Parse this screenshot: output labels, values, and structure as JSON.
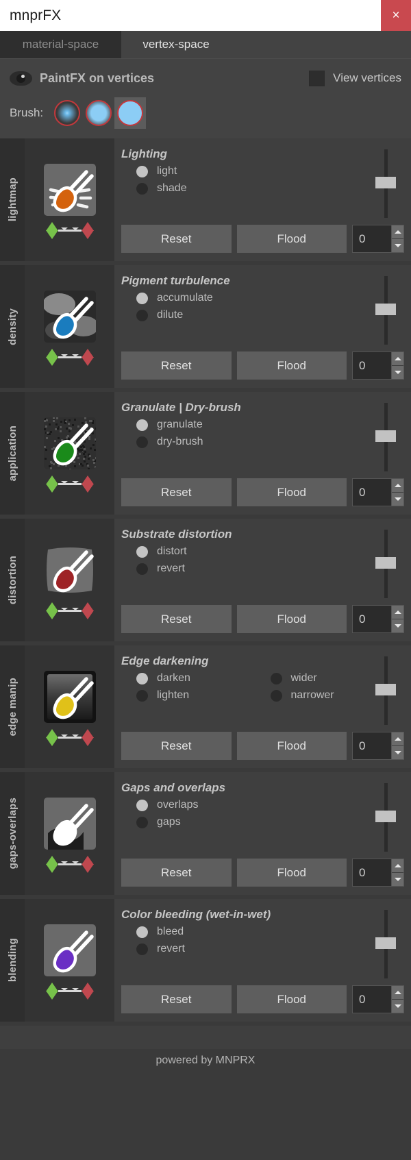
{
  "window": {
    "title": "mnprFX",
    "close_label": "×"
  },
  "tabs": [
    {
      "label": "material-space",
      "active": false
    },
    {
      "label": "vertex-space",
      "active": true
    }
  ],
  "top": {
    "eye_icon": "eye-icon",
    "paintfx_label": "PaintFX on vertices",
    "view_vertices_label": "View vertices",
    "view_vertices_checked": false,
    "brush_label": "Brush:",
    "brushes": [
      {
        "name": "brush-soft",
        "selected": false
      },
      {
        "name": "brush-medium",
        "selected": false
      },
      {
        "name": "brush-hard",
        "selected": true
      }
    ]
  },
  "buttons": {
    "reset_label": "Reset",
    "flood_label": "Flood"
  },
  "colors": {
    "accent_red": "#c4383c",
    "brush_blue": "#8ccdf5",
    "close_red": "#c9494f",
    "gradient_low": "#77c24a",
    "gradient_high": "#c0484f"
  },
  "panels": [
    {
      "rail": "lightmap",
      "title": "Lighting",
      "thumb_color": "#d4620d",
      "thumb_style": "rays",
      "options": [
        {
          "label": "light",
          "selected": true
        },
        {
          "label": "shade",
          "selected": false
        }
      ],
      "spin_value": "0",
      "slider_value": 50
    },
    {
      "rail": "density",
      "title": "Pigment turbulence",
      "thumb_color": "#1a7cbe",
      "thumb_style": "clouds",
      "options": [
        {
          "label": "accumulate",
          "selected": true
        },
        {
          "label": "dilute",
          "selected": false
        }
      ],
      "spin_value": "0",
      "slider_value": 50
    },
    {
      "rail": "application",
      "title": "Granulate | Dry-brush",
      "thumb_color": "#1a8a1a",
      "thumb_style": "grain",
      "options": [
        {
          "label": "granulate",
          "selected": true
        },
        {
          "label": "dry-brush",
          "selected": false
        }
      ],
      "spin_value": "0",
      "slider_value": 50
    },
    {
      "rail": "distortion",
      "title": "Substrate distortion",
      "thumb_color": "#9e2326",
      "thumb_style": "warp",
      "options": [
        {
          "label": "distort",
          "selected": true
        },
        {
          "label": "revert",
          "selected": false
        }
      ],
      "spin_value": "0",
      "slider_value": 50
    },
    {
      "rail": "edge manip",
      "title": "Edge darkening",
      "thumb_color": "#e0c119",
      "thumb_style": "edge",
      "two_col": true,
      "options": [
        {
          "label": "darken",
          "selected": true
        },
        {
          "label": "wider",
          "selected": false
        },
        {
          "label": "lighten",
          "selected": false
        },
        {
          "label": "narrower",
          "selected": false
        }
      ],
      "spin_value": "0",
      "slider_value": 50
    },
    {
      "rail": "gaps-overlaps",
      "title": "Gaps and overlaps",
      "thumb_color": "#ffffff",
      "thumb_style": "gaps",
      "options": [
        {
          "label": "overlaps",
          "selected": true
        },
        {
          "label": "gaps",
          "selected": false
        }
      ],
      "spin_value": "0",
      "slider_value": 50
    },
    {
      "rail": "blending",
      "title": "Color bleeding (wet-in-wet)",
      "thumb_color": "#6a2fc4",
      "thumb_style": "bleed",
      "options": [
        {
          "label": "bleed",
          "selected": true
        },
        {
          "label": "revert",
          "selected": false
        }
      ],
      "spin_value": "0",
      "slider_value": 50
    }
  ],
  "footer": {
    "text": "powered by MNPRX"
  }
}
